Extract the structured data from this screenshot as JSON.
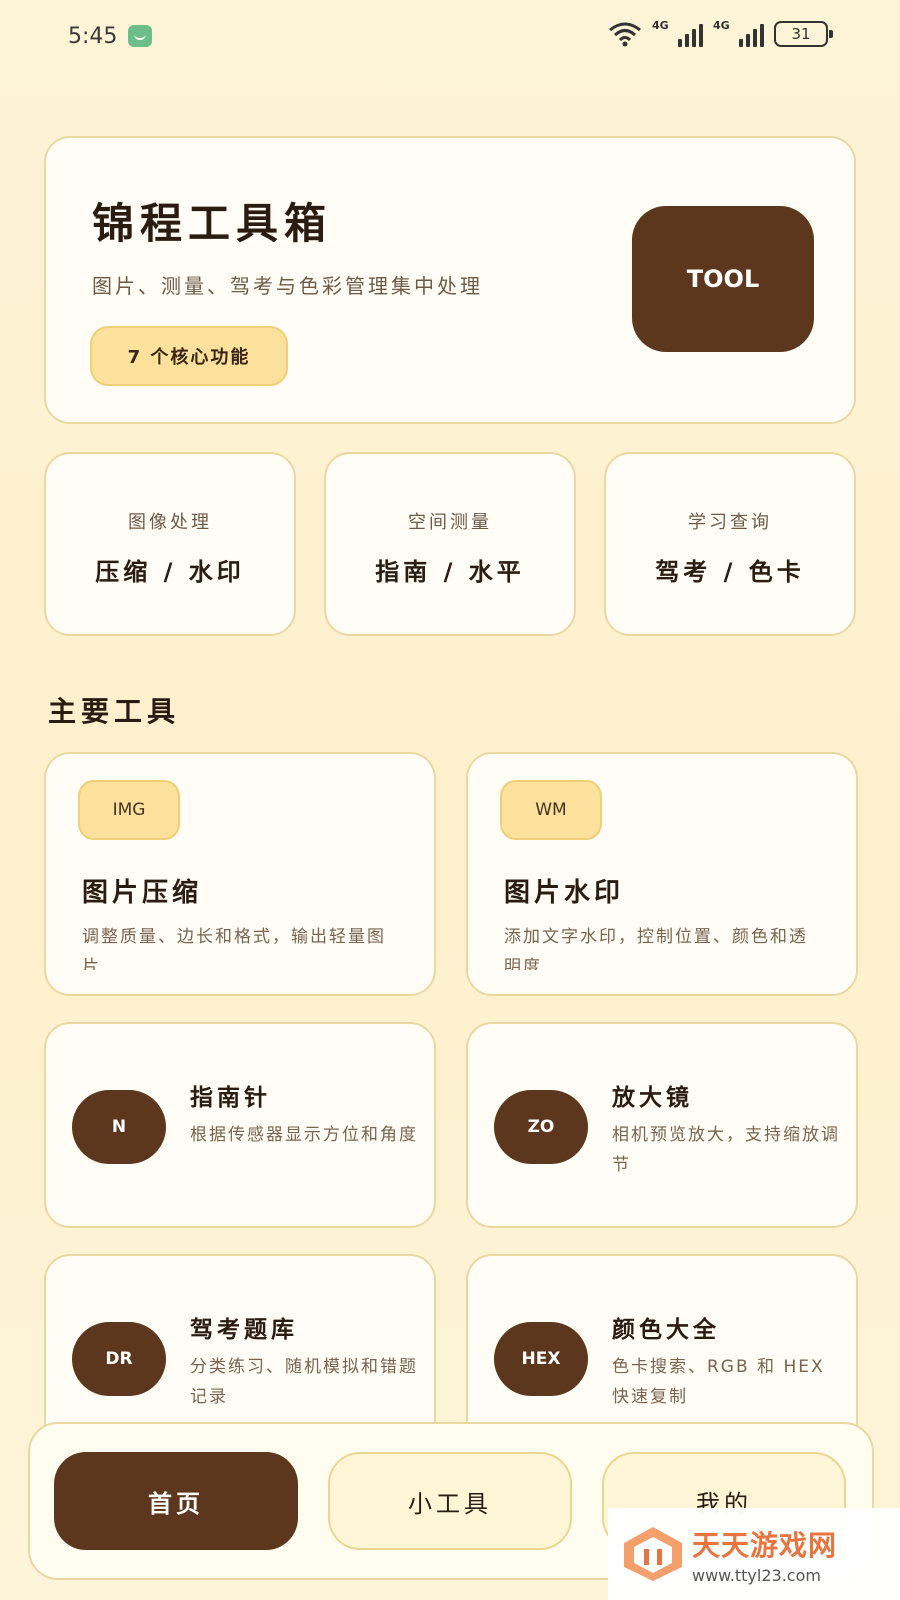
{
  "status_bar": {
    "time": "5:45",
    "net1": "4G",
    "net2": "4G",
    "battery": "31"
  },
  "hero": {
    "title": "锦程工具箱",
    "subtitle": "图片、测量、驾考与色彩管理集中处理",
    "badge": "7 个核心功能",
    "logo": "TOOL"
  },
  "categories": [
    {
      "small": "图像处理",
      "main": "压缩 / 水印"
    },
    {
      "small": "空间测量",
      "main": "指南 / 水平"
    },
    {
      "small": "学习查询",
      "main": "驾考 / 色卡"
    }
  ],
  "section_title": "主要工具",
  "tools": [
    {
      "icon": "IMG",
      "title": "图片压缩",
      "desc": "调整质量、边长和格式，输出轻量图片"
    },
    {
      "icon": "WM",
      "title": "图片水印",
      "desc": "添加文字水印，控制位置、颜色和透明度"
    },
    {
      "icon": "N",
      "title": "指南针",
      "desc": "根据传感器显示方位和角度"
    },
    {
      "icon": "ZO",
      "title": "放大镜",
      "desc": "相机预览放大，支持缩放调节"
    },
    {
      "icon": "DR",
      "title": "驾考题库",
      "desc": "分类练习、随机模拟和错题记录"
    },
    {
      "icon": "HEX",
      "title": "颜色大全",
      "desc": "色卡搜索、RGB 和 HEX 快速复制"
    }
  ],
  "nav": {
    "home": "首页",
    "tools": "小工具",
    "mine": "我的"
  },
  "watermark": {
    "name": "天天游戏网",
    "url": "www.ttyl23.com"
  },
  "colors": {
    "brown": "#5d371d",
    "accent_yellow": "#fbe19c",
    "background": "#fdf3d6"
  }
}
